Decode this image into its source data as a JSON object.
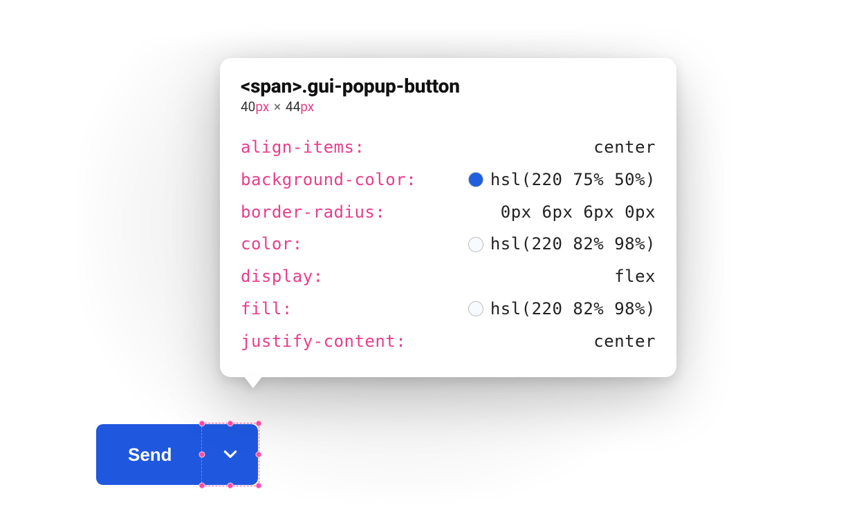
{
  "tooltip": {
    "element_tag": "<span>",
    "selector": ".gui-popup-button",
    "dimensions": {
      "width_value": "40",
      "width_unit": "px",
      "height_value": "44",
      "height_unit": "px",
      "times": "×"
    },
    "properties": [
      {
        "name": "align-items",
        "value": "center",
        "swatch": null
      },
      {
        "name": "background-color",
        "value": "hsl(220 75% 50%)",
        "swatch": "#2060df"
      },
      {
        "name": "border-radius",
        "value": "0px 6px 6px 0px",
        "swatch": null
      },
      {
        "name": "color",
        "value": "hsl(220 82% 98%)",
        "swatch": "#f7faff"
      },
      {
        "name": "display",
        "value": "flex",
        "swatch": null
      },
      {
        "name": "fill",
        "value": "hsl(220 82% 98%)",
        "swatch": "#f7faff"
      },
      {
        "name": "justify-content",
        "value": "center",
        "swatch": null
      }
    ]
  },
  "button": {
    "main_label": "Send"
  },
  "colors": {
    "accent": "#1f58df",
    "property_name": "#e83e8c",
    "selection": "#ff4da6"
  }
}
